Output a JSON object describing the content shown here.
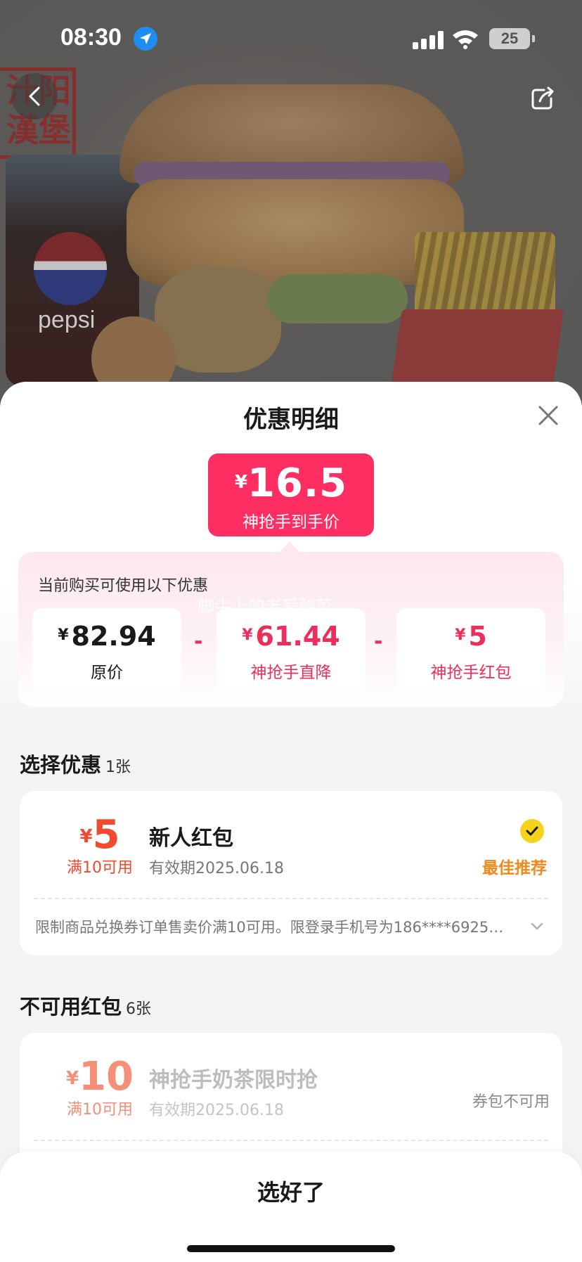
{
  "status_bar": {
    "time": "08:30",
    "battery": "25"
  },
  "hero": {
    "logo_text": "汁阳漢堡",
    "cup_brand": "pepsi"
  },
  "sheet": {
    "title": "优惠明细",
    "final_price": {
      "currency": "¥",
      "amount": "16.5",
      "label": "神抢手到手价"
    },
    "panel": {
      "heading": "当前购买可使用以下优惠",
      "watermark": "脚尖上的老爱酸菜",
      "items": [
        {
          "currency": "¥",
          "value": "82.94",
          "label": "原价"
        },
        {
          "currency": "¥",
          "value": "61.44",
          "label": "神抢手直降"
        },
        {
          "currency": "¥",
          "value": "5",
          "label": "神抢手红包"
        }
      ],
      "operators": [
        "-",
        "-"
      ]
    },
    "select_section": {
      "title": "选择优惠",
      "count": "1张"
    },
    "selected_coupon": {
      "currency": "¥",
      "value": "5",
      "condition": "满10可用",
      "name": "新人红包",
      "expiry": "有效期2025.06.18",
      "badge": "最佳推荐",
      "description": "限制商品兑换券订单售卖价满10可用。限登录手机号为186****6925…"
    },
    "unavailable_section": {
      "title": "不可用红包",
      "count": "6张"
    },
    "unavailable_coupon": {
      "currency": "¥",
      "value": "10",
      "condition": "满10可用",
      "name": "神抢手奶茶限时抢",
      "expiry": "有效期2025.06.18",
      "status": "券包不可用"
    }
  },
  "footer": {
    "confirm_label": "选好了"
  },
  "colors": {
    "accent": "#ff2e62",
    "coupon_red": "#f24a2e",
    "best_orange": "#f08a1e",
    "check_yellow": "#f5d31a"
  },
  "icons": [
    "location-arrow-icon",
    "signal-icon",
    "wifi-icon",
    "battery-icon",
    "back-arrow-icon",
    "share-icon",
    "close-icon",
    "check-icon",
    "chevron-down-icon"
  ]
}
